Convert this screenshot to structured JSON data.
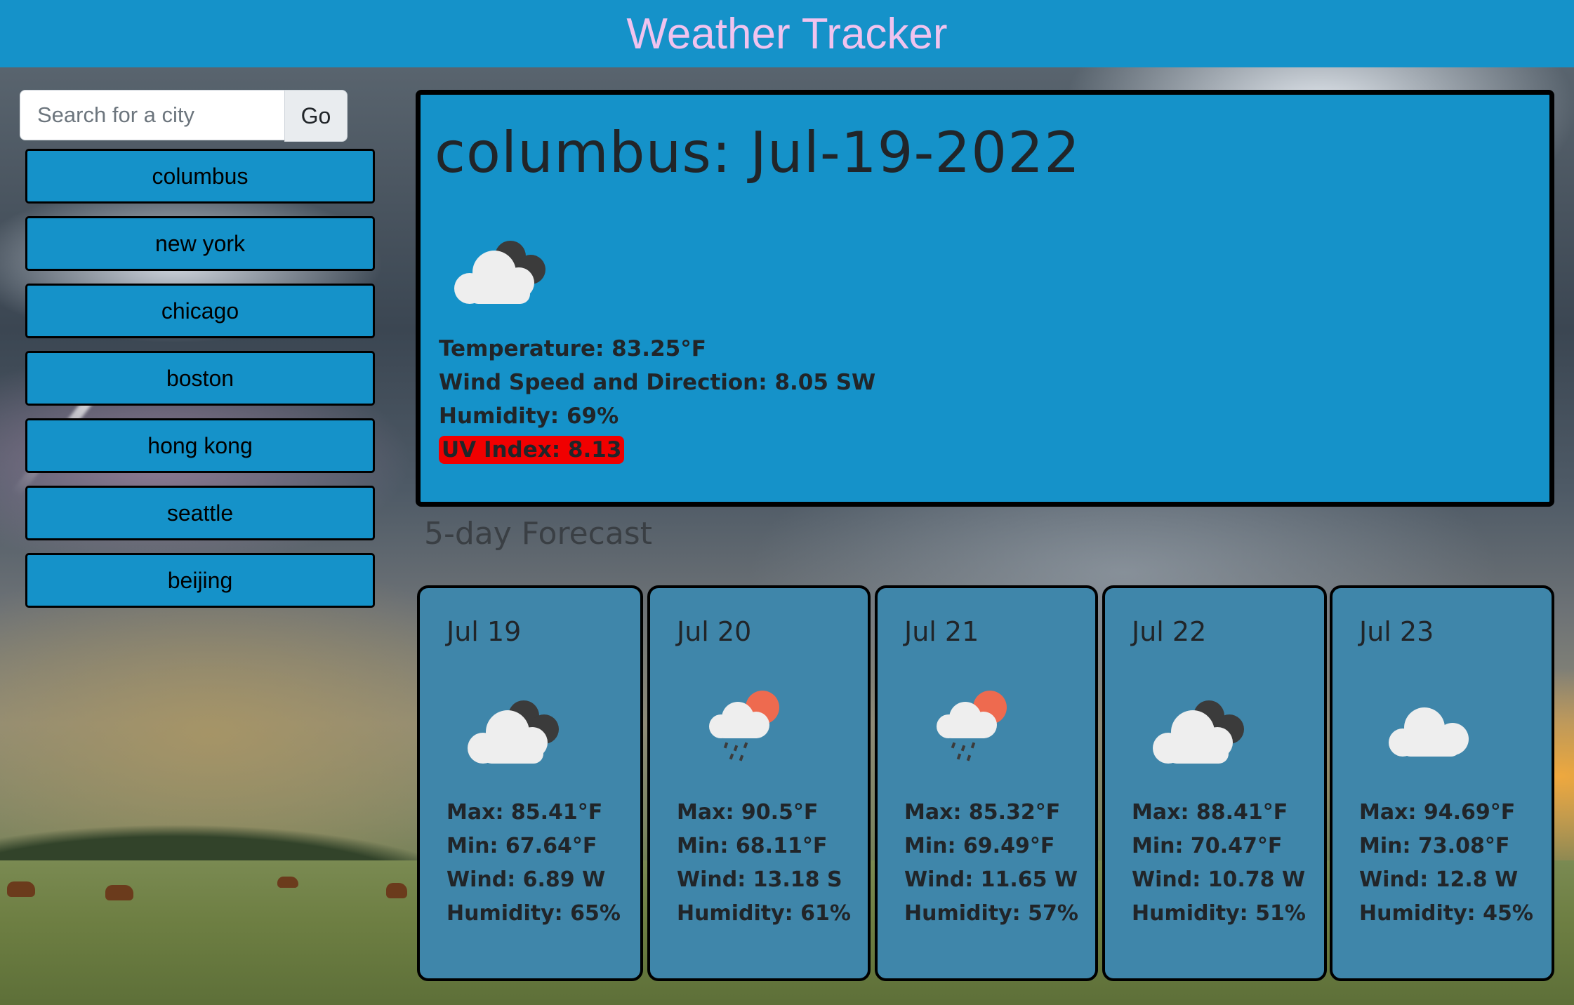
{
  "header": {
    "title": "Weather Tracker"
  },
  "search": {
    "placeholder": "Search for a city",
    "button_label": "Go"
  },
  "history": [
    "columbus",
    "new york",
    "chicago",
    "boston",
    "hong kong",
    "seattle",
    "beijing"
  ],
  "current": {
    "title": "columbus: Jul-19-2022",
    "icon": "broken-clouds-icon",
    "temperature": "Temperature: 83.25°F",
    "wind": "Wind Speed and Direction: 8.05 SW",
    "humidity": "Humidity: 69%",
    "uv": "UV Index: 8.13"
  },
  "forecast_title": "5-day Forecast",
  "forecast": [
    {
      "date": "Jul 19",
      "icon": "broken-clouds-icon",
      "max": "Max: 85.41°F",
      "min": "Min: 67.64°F",
      "wind": "Wind: 6.89 W",
      "humidity": "Humidity: 65%"
    },
    {
      "date": "Jul 20",
      "icon": "rain-sun-icon",
      "max": "Max: 90.5°F",
      "min": "Min: 68.11°F",
      "wind": "Wind: 13.18 S",
      "humidity": "Humidity: 61%"
    },
    {
      "date": "Jul 21",
      "icon": "rain-sun-icon",
      "max": "Max: 85.32°F",
      "min": "Min: 69.49°F",
      "wind": "Wind: 11.65 W",
      "humidity": "Humidity: 57%"
    },
    {
      "date": "Jul 22",
      "icon": "broken-clouds-icon",
      "max": "Max: 88.41°F",
      "min": "Min: 70.47°F",
      "wind": "Wind: 10.78 W",
      "humidity": "Humidity: 51%"
    },
    {
      "date": "Jul 23",
      "icon": "cloud-icon",
      "max": "Max: 94.69°F",
      "min": "Min: 73.08°F",
      "wind": "Wind: 12.8 W",
      "humidity": "Humidity: 45%"
    }
  ],
  "colors": {
    "header": "#1592c9",
    "title": "#f0c3ee",
    "card": "#3f86aa",
    "uv_high": "#f10000"
  }
}
